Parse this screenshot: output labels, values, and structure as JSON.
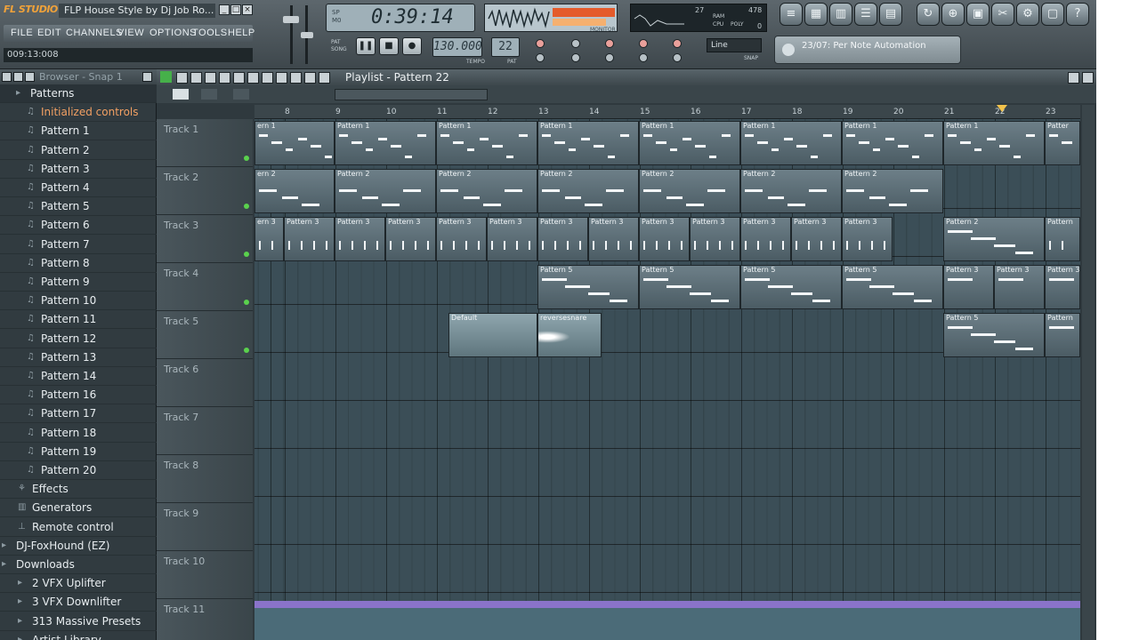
{
  "app": {
    "logo": "FL STUDIO",
    "title": "FLP House Style by Dj Job Ro...",
    "song_position": "009:13:008"
  },
  "menu": [
    "FILE",
    "EDIT",
    "CHANNELS",
    "VIEW",
    "OPTIONS",
    "TOOLS",
    "HELP"
  ],
  "transport": {
    "time": "0:39:14",
    "time_mode_top": "SP",
    "time_mode_bottom": "M0",
    "tempo": "130.000",
    "tempo_label": "TEMPO",
    "pattern": "22",
    "pattern_label": "PAT",
    "pat_label": "PAT",
    "song_label": "SONG",
    "monitor_label": "MONITOR"
  },
  "cpu": {
    "voices": "27",
    "ram": "478",
    "poly": "0",
    "ram_label": "RAM",
    "cpu_label": "CPU",
    "poly_label": "POLY"
  },
  "snap": {
    "value": "Line",
    "label": "SNAP"
  },
  "hint": {
    "text": "23/07: Per Note Automation"
  },
  "browser": {
    "title": "Browser - Snap 1",
    "items": [
      {
        "label": "Patterns",
        "icon": "folder"
      },
      {
        "label": "Initialized controls",
        "icon": "note"
      },
      {
        "label": "Pattern 1",
        "icon": "note"
      },
      {
        "label": "Pattern 2",
        "icon": "note"
      },
      {
        "label": "Pattern 3",
        "icon": "note"
      },
      {
        "label": "Pattern 4",
        "icon": "note"
      },
      {
        "label": "Pattern 5",
        "icon": "note"
      },
      {
        "label": "Pattern 6",
        "icon": "note"
      },
      {
        "label": "Pattern 7",
        "icon": "note"
      },
      {
        "label": "Pattern 8",
        "icon": "note"
      },
      {
        "label": "Pattern 9",
        "icon": "note"
      },
      {
        "label": "Pattern 10",
        "icon": "note"
      },
      {
        "label": "Pattern 11",
        "icon": "note"
      },
      {
        "label": "Pattern 12",
        "icon": "note"
      },
      {
        "label": "Pattern 13",
        "icon": "note"
      },
      {
        "label": "Pattern 14",
        "icon": "note"
      },
      {
        "label": "Pattern 16",
        "icon": "note"
      },
      {
        "label": "Pattern 17",
        "icon": "note"
      },
      {
        "label": "Pattern 18",
        "icon": "note"
      },
      {
        "label": "Pattern 19",
        "icon": "note"
      },
      {
        "label": "Pattern 20",
        "icon": "note"
      },
      {
        "label": "Effects",
        "icon": "fx"
      },
      {
        "label": "Generators",
        "icon": "gen"
      },
      {
        "label": "Remote control",
        "icon": "remote"
      },
      {
        "label": "DJ-FoxHound (EZ)",
        "icon": "folder"
      },
      {
        "label": "Downloads",
        "icon": "folder"
      },
      {
        "label": "2 VFX Uplifter",
        "icon": "folder"
      },
      {
        "label": "3 VFX Downlifter",
        "icon": "folder"
      },
      {
        "label": "313 Massive Presets",
        "icon": "folder"
      },
      {
        "label": "Artist Library",
        "icon": "folder"
      }
    ]
  },
  "playlist": {
    "title": "Playlist - Pattern 22",
    "tracks": [
      "Track 1",
      "Track 2",
      "Track 3",
      "Track 4",
      "Track 5",
      "Track 6",
      "Track 7",
      "Track 8",
      "Track 9",
      "Track 10",
      "Track 11"
    ],
    "bars": [
      "8",
      "9",
      "10",
      "11",
      "12",
      "13",
      "14",
      "15",
      "16",
      "17",
      "18",
      "19",
      "20",
      "21",
      "22",
      "23"
    ],
    "clips": [
      {
        "track": 0,
        "label": "ern 1"
      },
      {
        "track": 0,
        "label": "Pattern 1"
      },
      {
        "track": 0,
        "label": "Pattern 1"
      },
      {
        "track": 0,
        "label": "Pattern 1"
      },
      {
        "track": 0,
        "label": "Pattern 1"
      },
      {
        "track": 0,
        "label": "Pattern 1"
      },
      {
        "track": 0,
        "label": "Pattern 1"
      },
      {
        "track": 0,
        "label": "Pattern 1"
      },
      {
        "track": 0,
        "label": "Patter"
      },
      {
        "track": 1,
        "label": "ern 2"
      },
      {
        "track": 1,
        "label": "Pattern 2"
      },
      {
        "track": 1,
        "label": "Pattern 2"
      },
      {
        "track": 1,
        "label": "Pattern 2"
      },
      {
        "track": 1,
        "label": "Pattern 2"
      },
      {
        "track": 1,
        "label": "Pattern 2"
      },
      {
        "track": 1,
        "label": "Pattern 2"
      },
      {
        "track": 2,
        "label": "ern 3"
      },
      {
        "track": 2,
        "label": "Pattern 3"
      },
      {
        "track": 2,
        "label": "Pattern 3"
      },
      {
        "track": 2,
        "label": "Pattern 3"
      },
      {
        "track": 2,
        "label": "Pattern 3"
      },
      {
        "track": 2,
        "label": "Pattern 3"
      },
      {
        "track": 2,
        "label": "Pattern 3"
      },
      {
        "track": 2,
        "label": "Pattern 3"
      },
      {
        "track": 2,
        "label": "Pattern 3"
      },
      {
        "track": 2,
        "label": "Pattern 3"
      },
      {
        "track": 2,
        "label": "Pattern 3"
      },
      {
        "track": 2,
        "label": "Pattern 3"
      },
      {
        "track": 2,
        "label": "Pattern 3"
      },
      {
        "track": 2,
        "label": "Pattern 2"
      },
      {
        "track": 2,
        "label": "Pattern"
      },
      {
        "track": 3,
        "label": "Pattern 5"
      },
      {
        "track": 3,
        "label": "Pattern 5"
      },
      {
        "track": 3,
        "label": "Pattern 5"
      },
      {
        "track": 3,
        "label": "Pattern 5"
      },
      {
        "track": 3,
        "label": "Pattern 3"
      },
      {
        "track": 3,
        "label": "Pattern 3"
      },
      {
        "track": 3,
        "label": "Pattern 3"
      },
      {
        "track": 4,
        "label": "Default"
      },
      {
        "track": 4,
        "label": "reversesnare"
      },
      {
        "track": 4,
        "label": "Pattern 5"
      },
      {
        "track": 4,
        "label": "Pattern"
      }
    ]
  }
}
